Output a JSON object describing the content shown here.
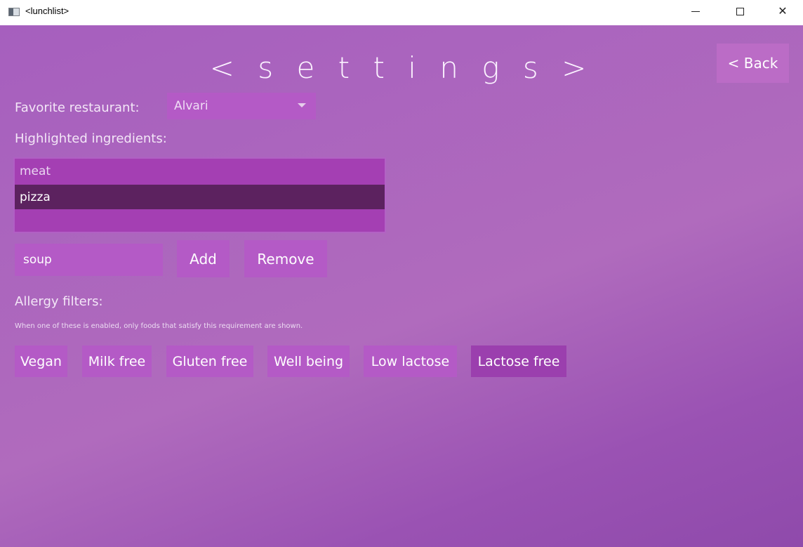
{
  "window": {
    "title": "<lunchlist>",
    "minimize_glyph": "",
    "maximize_glyph": "",
    "close_glyph": "✕"
  },
  "header": {
    "title": "< s e t t i n g s >",
    "back_label": "< Back"
  },
  "favorite": {
    "label": "Favorite restaurant:",
    "selected": "Alvari"
  },
  "ingredients": {
    "label": "Highlighted ingredients:",
    "items": [
      "meat",
      "pizza"
    ],
    "selected_index": 1,
    "input_value": "soup",
    "add_label": "Add",
    "remove_label": "Remove"
  },
  "allergy": {
    "label": "Allergy filters:",
    "note": "When one of these is enabled, only foods that satisfy this requirement are shown.",
    "filters": [
      {
        "label": "Vegan",
        "enabled": false
      },
      {
        "label": "Milk free",
        "enabled": false
      },
      {
        "label": "Gluten free",
        "enabled": false
      },
      {
        "label": "Well being",
        "enabled": false
      },
      {
        "label": "Low lactose",
        "enabled": false
      },
      {
        "label": "Lactose free",
        "enabled": true
      }
    ]
  },
  "colors": {
    "background": "#a65fbe",
    "control": "#b45ac6",
    "list_background": "#a43fb3",
    "list_selected": "#5c225f",
    "active_filter": "#9b3fae"
  }
}
